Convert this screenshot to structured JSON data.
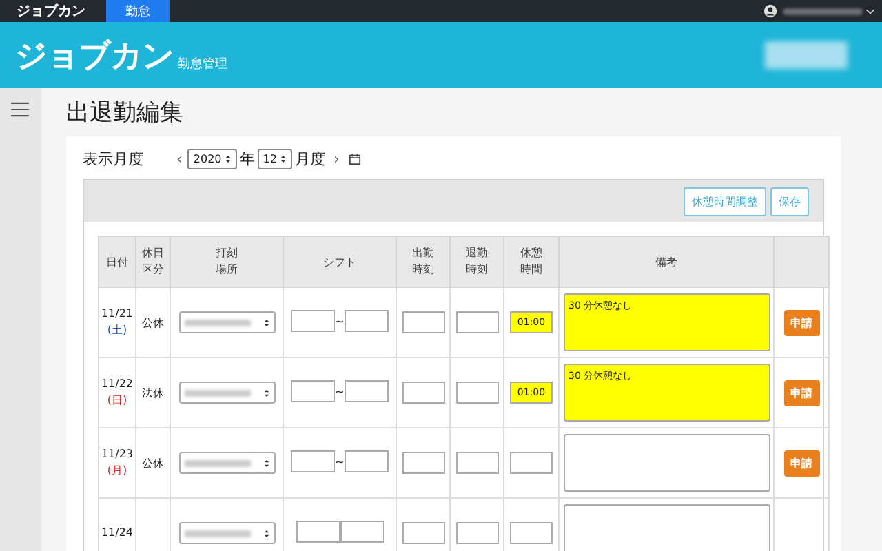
{
  "topbar": {
    "brand": "ジョブカン",
    "tabs": [
      {
        "label": "勤怠",
        "selected": true
      }
    ]
  },
  "header": {
    "logo": "ジョブカン",
    "subtitle": "勤怠管理"
  },
  "page_title": "出退勤編集",
  "month_picker": {
    "label": "表示月度",
    "prev": "‹",
    "year": "2020",
    "year_unit": "年",
    "month": "12",
    "month_unit": "月度",
    "next": "›"
  },
  "toolbar": {
    "buttons": [
      "休憩時間調整",
      "保存"
    ]
  },
  "table": {
    "columns": [
      "日付",
      "休日区分",
      "打刻場所",
      "シフト",
      "出勤時刻",
      "退勤時刻",
      "休憩時間",
      "備考",
      ""
    ],
    "rows": [
      {
        "date": "11/21",
        "day": "(土)",
        "color": "#1a56c8",
        "category": "公休",
        "shift_separator": "~",
        "break_time": "01:00",
        "break_highlighted": true,
        "note": "30 分休憩なし",
        "note_highlighted": true,
        "apply": "申請"
      },
      {
        "date": "11/22",
        "day": "(日)",
        "color": "#e02020",
        "category": "法休",
        "shift_separator": "~",
        "break_time": "01:00",
        "break_highlighted": true,
        "note": "30 分休憩なし",
        "note_highlighted": true,
        "apply": "申請"
      },
      {
        "date": "11/23",
        "day": "(月)",
        "color": "#e02020",
        "category": "公休",
        "shift_separator": "~",
        "break_highlighted": false,
        "note_highlighted": false,
        "apply": "申請"
      },
      {
        "date": "11/24"
      }
    ]
  }
}
